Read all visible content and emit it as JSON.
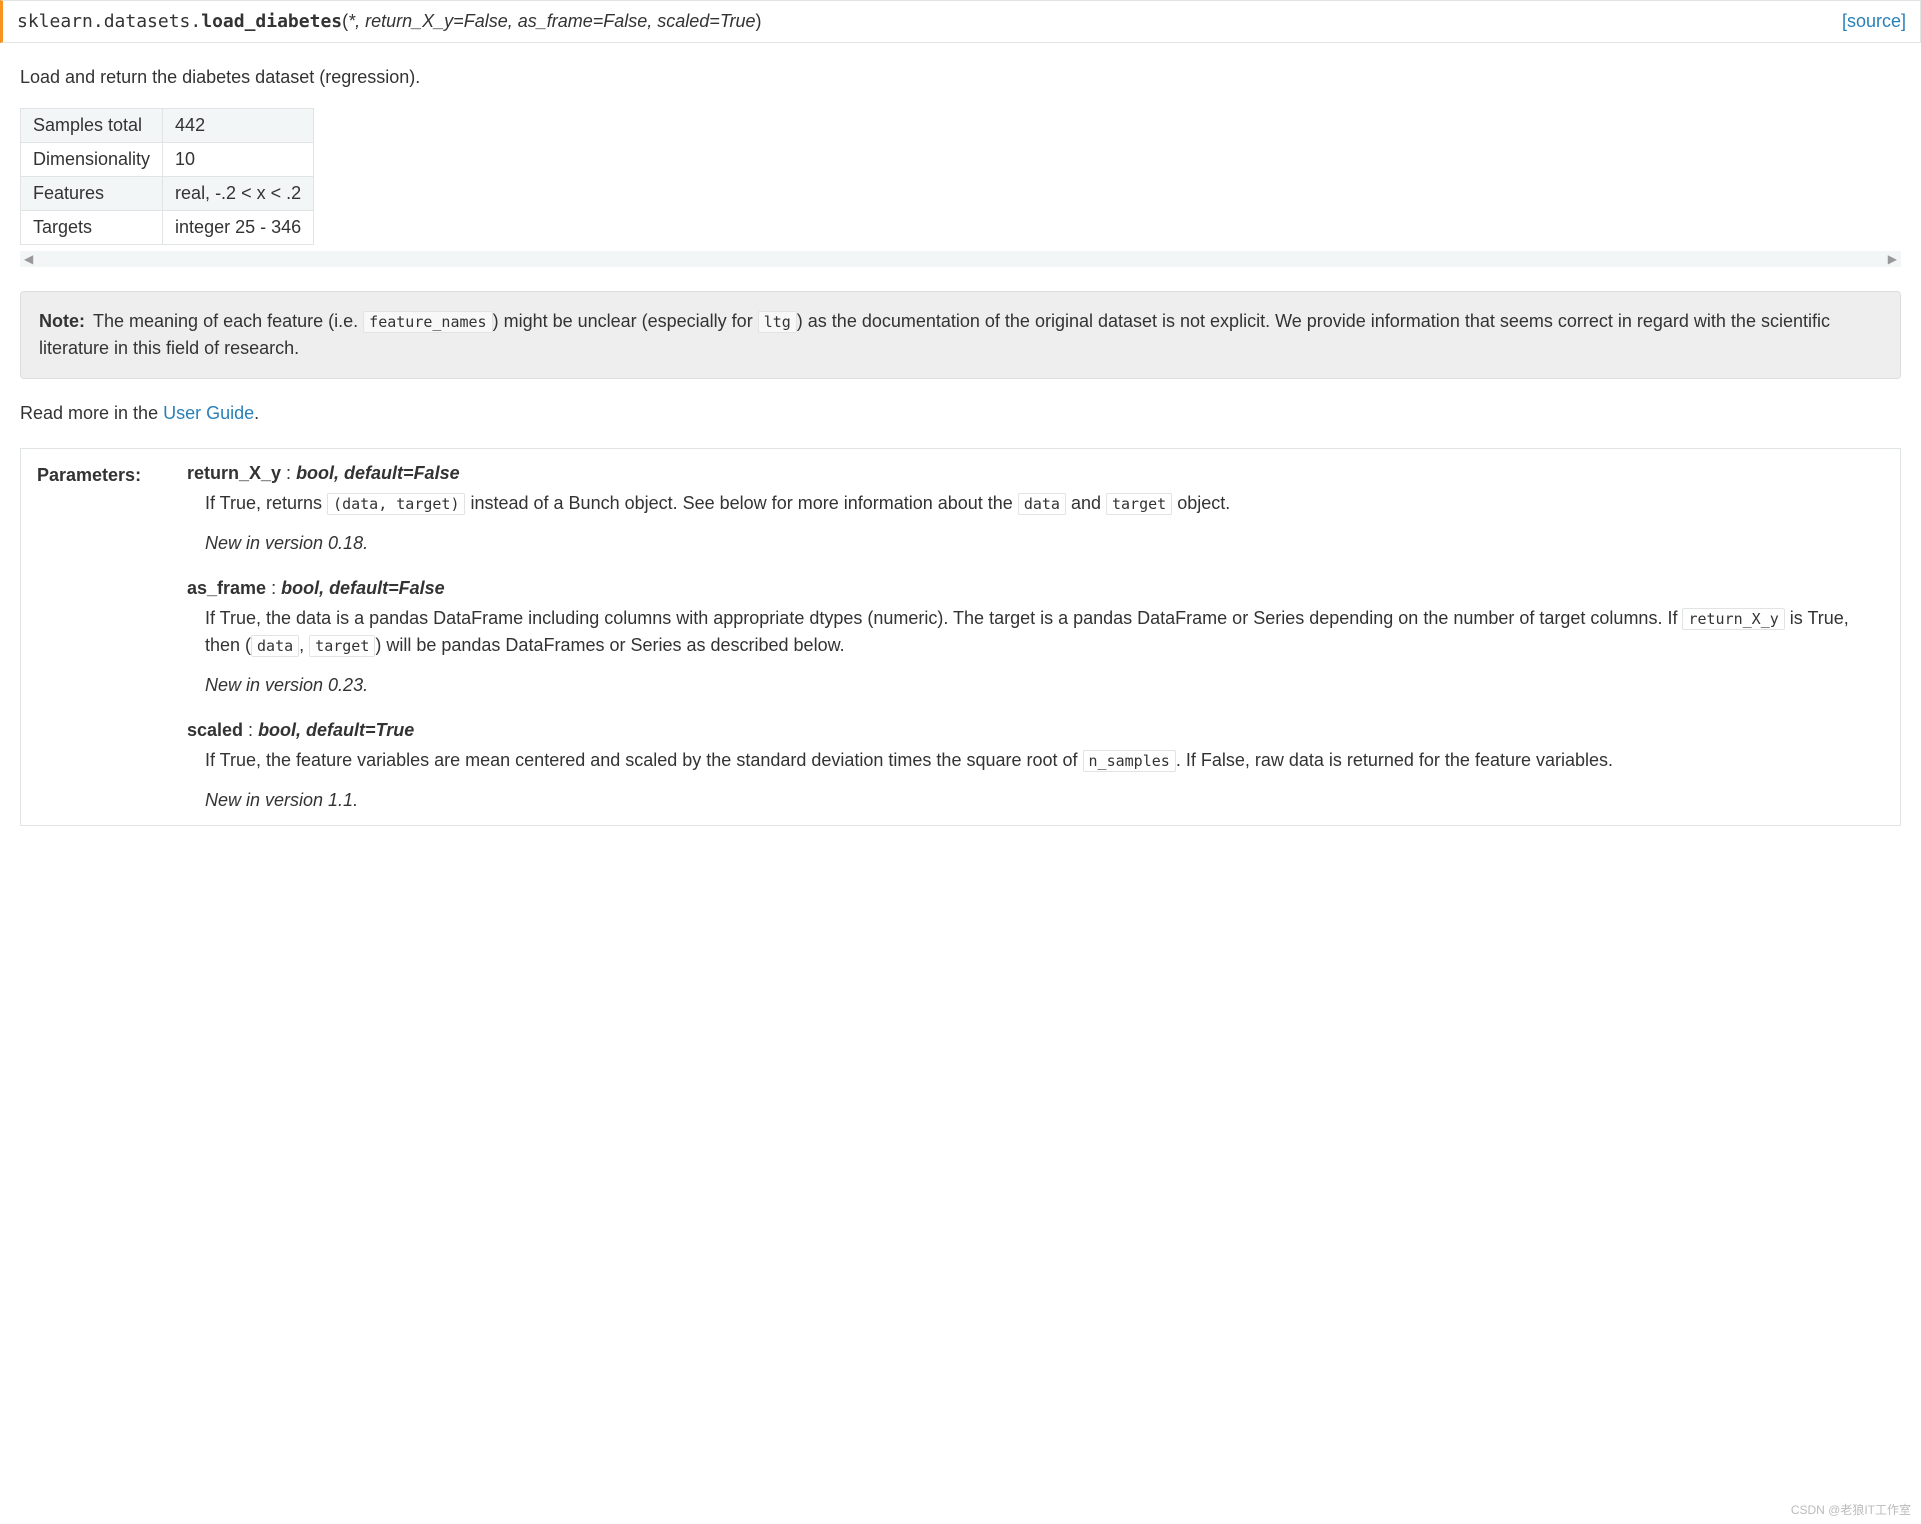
{
  "signature": {
    "module": "sklearn.datasets.",
    "name": "load_diabetes",
    "params": "*, return_X_y=False, as_frame=False, scaled=True",
    "source_label": "[source]"
  },
  "description": "Load and return the diabetes dataset (regression).",
  "info_table": [
    {
      "label": "Samples total",
      "value": "442"
    },
    {
      "label": "Dimensionality",
      "value": "10"
    },
    {
      "label": "Features",
      "value": "real, -.2 < x < .2"
    },
    {
      "label": "Targets",
      "value": "integer 25 - 346"
    }
  ],
  "scroll_hint": {
    "left": "◀",
    "right": "▶"
  },
  "note": {
    "label": "Note:",
    "pre1": "The meaning of each feature (i.e. ",
    "code1": "feature_names",
    "mid1": ") might be unclear (especially for ",
    "code2": "ltg",
    "post1": ") as the documentation of the original dataset is not explicit. We provide information that seems correct in regard with the scientific literature in this field of research."
  },
  "read_more": {
    "prefix": "Read more in the ",
    "link": "User Guide",
    "suffix": "."
  },
  "parameters_label": "Parameters:",
  "params": [
    {
      "name": "return_X_y",
      "type": "bool, default=False",
      "desc_parts": [
        {
          "t": "text",
          "v": "If True, returns "
        },
        {
          "t": "code",
          "v": "(data, target)"
        },
        {
          "t": "text",
          "v": " instead of a Bunch object. See below for more information about the "
        },
        {
          "t": "code",
          "v": "data"
        },
        {
          "t": "text",
          "v": " and "
        },
        {
          "t": "code",
          "v": "target"
        },
        {
          "t": "text",
          "v": " object."
        }
      ],
      "version": "New in version 0.18."
    },
    {
      "name": "as_frame",
      "type": "bool, default=False",
      "desc_parts": [
        {
          "t": "text",
          "v": "If True, the data is a pandas DataFrame including columns with appropriate dtypes (numeric). The target is a pandas DataFrame or Series depending on the number of target columns. If "
        },
        {
          "t": "code",
          "v": "return_X_y"
        },
        {
          "t": "text",
          "v": " is True, then ("
        },
        {
          "t": "code",
          "v": "data"
        },
        {
          "t": "text",
          "v": ", "
        },
        {
          "t": "code",
          "v": "target"
        },
        {
          "t": "text",
          "v": ") will be pandas DataFrames or Series as described below."
        }
      ],
      "version": "New in version 0.23."
    },
    {
      "name": "scaled",
      "type": "bool, default=True",
      "desc_parts": [
        {
          "t": "text",
          "v": "If True, the feature variables are mean centered and scaled by the standard deviation times the square root of "
        },
        {
          "t": "code",
          "v": "n_samples"
        },
        {
          "t": "text",
          "v": ". If False, raw data is returned for the feature variables."
        }
      ],
      "version": "New in version 1.1."
    }
  ],
  "watermark": "CSDN @老狼IT工作室"
}
